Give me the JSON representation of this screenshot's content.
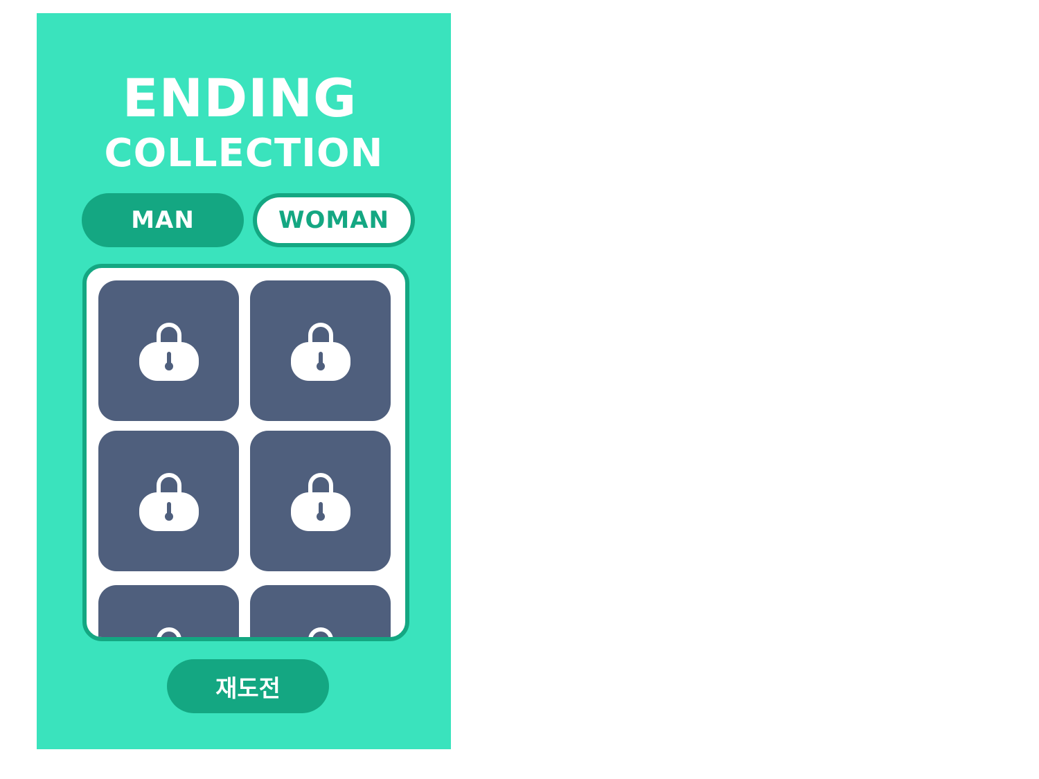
{
  "title": {
    "line1": "ENDING",
    "line2": "COLLECTION"
  },
  "tabs": [
    {
      "label": "MAN",
      "selected": true
    },
    {
      "label": "WOMAN",
      "selected": false
    }
  ],
  "collection": {
    "cells": [
      {
        "state": "locked",
        "icon": "lock-icon"
      },
      {
        "state": "locked",
        "icon": "lock-icon"
      },
      {
        "state": "locked",
        "icon": "lock-icon"
      },
      {
        "state": "locked",
        "icon": "lock-icon"
      },
      {
        "state": "locked",
        "icon": "lock-icon"
      },
      {
        "state": "locked",
        "icon": "lock-icon"
      }
    ]
  },
  "retry_button": {
    "label": "재도전"
  },
  "colors": {
    "background": "#3ae3bd",
    "accent": "#14a782",
    "cell": "#4f5f7d",
    "text": "#ffffff"
  }
}
